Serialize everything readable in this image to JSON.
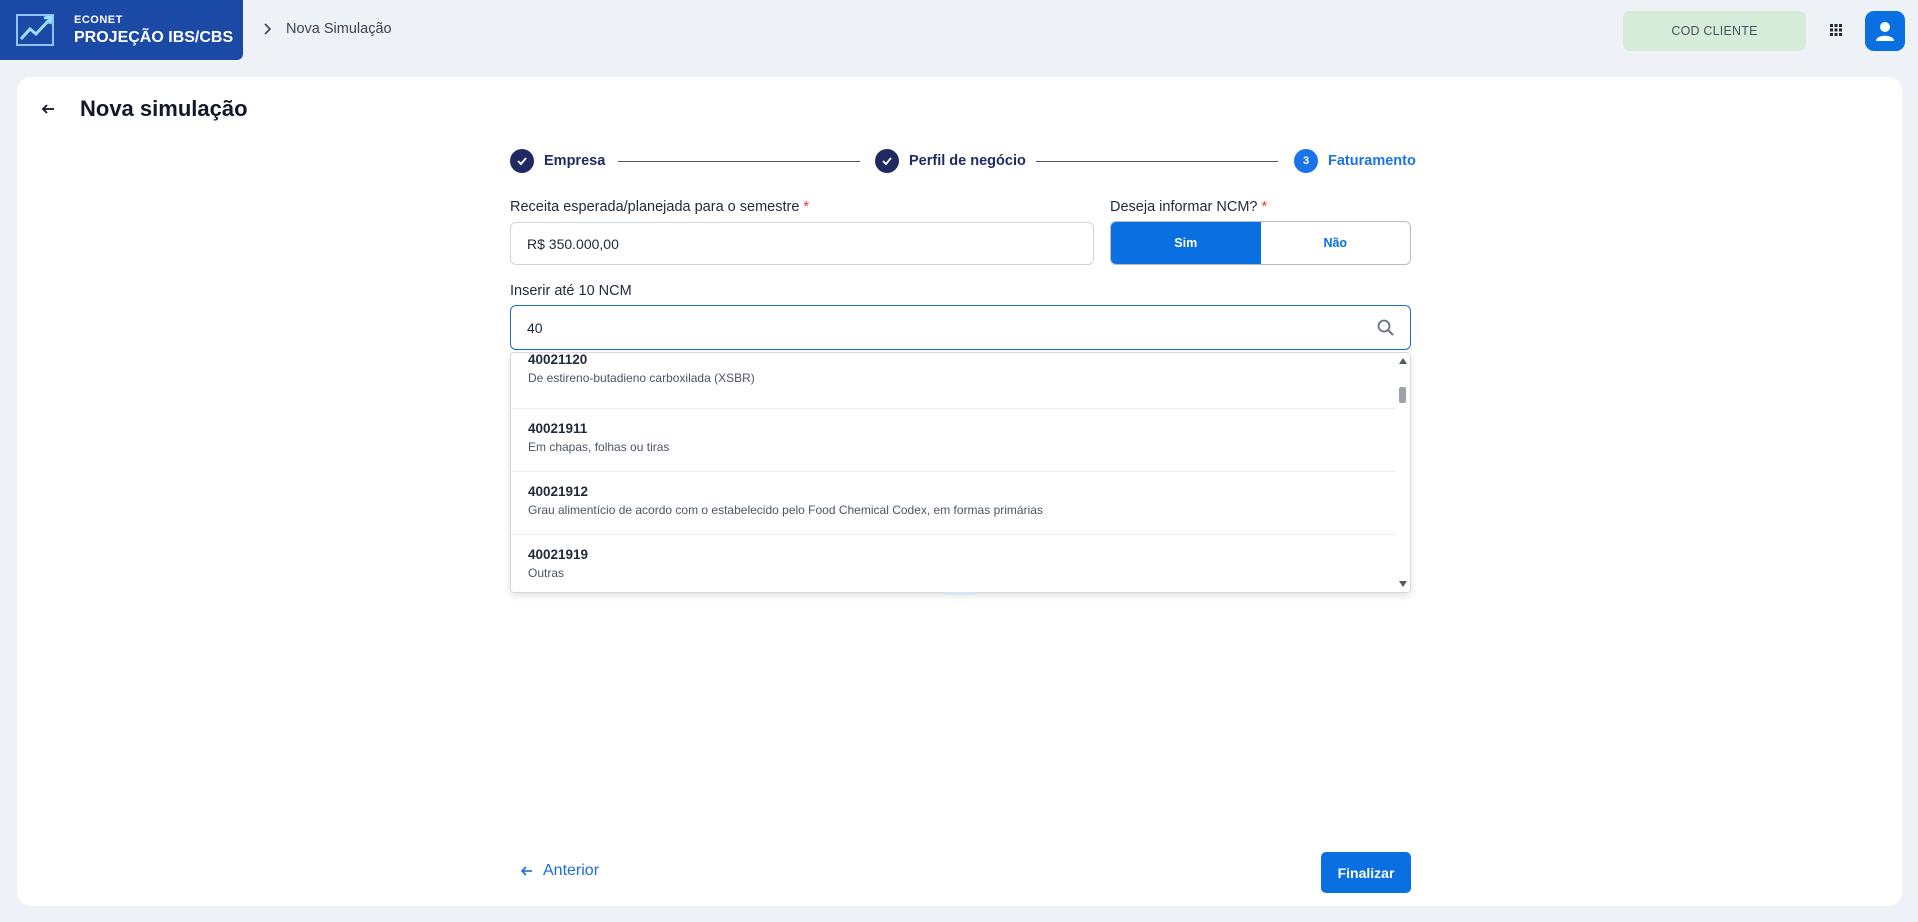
{
  "brand": {
    "small": "ECONET",
    "big": "PROJEÇÃO IBS/CBS"
  },
  "breadcrumb": {
    "current": "Nova Simulação"
  },
  "header": {
    "client_code_label": "COD CLIENTE",
    "apps_icon": "grid-icon",
    "user_icon": "user-icon"
  },
  "page": {
    "title": "Nova simulação"
  },
  "stepper": {
    "steps": [
      {
        "label": "Empresa",
        "state": "done"
      },
      {
        "label": "Perfil de negócio",
        "state": "done"
      },
      {
        "label": "Faturamento",
        "state": "active",
        "number": "3"
      }
    ]
  },
  "form": {
    "revenue_label": "Receita esperada/planejada para o semestre",
    "revenue_value": "R$ 350.000,00",
    "ncm_question_label": "Deseja informar NCM?",
    "required_mark": "*",
    "ncm_yes": "Sim",
    "ncm_no": "Não",
    "ncm_selected": "Sim",
    "ncm_search_label": "Inserir até 10 NCM",
    "ncm_search_value": "40"
  },
  "dropdown": {
    "items": [
      {
        "code": "40021120",
        "desc": "De estireno-butadieno carboxilada (XSBR)"
      },
      {
        "code": "40021911",
        "desc": "Em chapas, folhas ou tiras"
      },
      {
        "code": "40021912",
        "desc": "Grau alimentício de acordo com o estabelecido pelo Food Chemical Codex, em formas primárias"
      },
      {
        "code": "40021919",
        "desc": "Outras"
      }
    ]
  },
  "footer": {
    "previous": "Anterior",
    "finish": "Finalizar"
  },
  "colors": {
    "primary": "#0a6fe0",
    "brand_bg": "#1b49a6",
    "step_done": "#1f2a63",
    "client_code_bg": "#d6ebd8"
  }
}
